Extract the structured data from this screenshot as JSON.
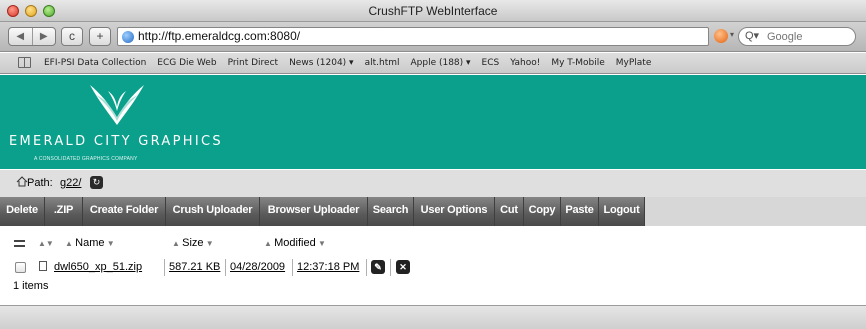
{
  "window": {
    "title": "CrushFTP WebInterface"
  },
  "toolbar": {
    "back_label": "◀",
    "forward_label": "▶",
    "reload_label": "c",
    "add_label": "+",
    "url": "http://ftp.emeraldcg.com:8080/",
    "search_placeholder": "Google"
  },
  "bookmarks": [
    "EFI-PSI Data Collection",
    "ECG Die Web",
    "Print Direct",
    "News (1204) ▾",
    "alt.html",
    "Apple (188) ▾",
    "ECS",
    "Yahoo!",
    "My T-Mobile",
    "MyPlate"
  ],
  "banner": {
    "brand": "EMERALD CITY GRAPHICS",
    "subtitle": "A CONSOLIDATED GRAPHICS COMPANY",
    "brand_color": "#0aa08c"
  },
  "path": {
    "label": "Path:",
    "value": "g22/"
  },
  "commands": [
    "Delete",
    ".ZIP",
    "Create Folder",
    "Crush Uploader",
    "Browser Uploader",
    "Search",
    "User Options",
    "Cut",
    "Copy",
    "Paste",
    "Logout"
  ],
  "columns": {
    "name": "Name",
    "size": "Size",
    "modified": "Modified"
  },
  "files": [
    {
      "name": "dwl650_xp_51.zip",
      "size": "587.21 KB",
      "date": "04/28/2009",
      "time": "12:37:18 PM"
    }
  ],
  "footer": {
    "count": "1 items"
  },
  "icons": {
    "home": "home-icon",
    "refresh": "refresh-icon",
    "file": "file-icon",
    "edit": "pencil-icon",
    "delete": "close-icon"
  }
}
